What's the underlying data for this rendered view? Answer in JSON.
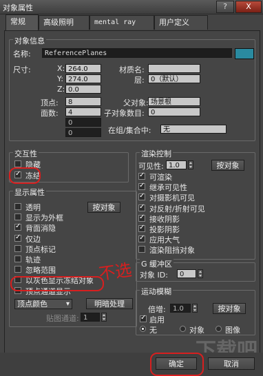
{
  "window": {
    "title": "对象属性",
    "help_btn": "?",
    "close_btn": "X"
  },
  "tabs": [
    "常规",
    "高级照明",
    "mental ray",
    "用户定义"
  ],
  "object_info": {
    "group_title": "对象信息",
    "name_label": "名称:",
    "name_value": "ReferencePlanes",
    "color": "#2a8aa0",
    "size_label": "尺寸:",
    "x_label": "X:",
    "x_value": "264.0",
    "y_label": "Y:",
    "y_value": "274.0",
    "z_label": "Z:",
    "z_value": "0.0",
    "material_label": "材质名:",
    "material_value": "",
    "layer_label": "层:",
    "layer_value": "0（默认）",
    "vertices_label": "顶点:",
    "vertices_value": "8",
    "faces_label": "面数:",
    "faces_value": "4",
    "extra1_value": "0",
    "extra2_value": "0",
    "parent_label": "父对象:",
    "parent_value": "场景根",
    "children_label": "子对象数目:",
    "children_value": "0",
    "in_group_label": "在组/集合中:",
    "in_group_value": "无"
  },
  "interaction": {
    "group_title": "交互性",
    "hide": {
      "label": "隐藏",
      "checked": false
    },
    "freeze": {
      "label": "冻结",
      "checked": true
    }
  },
  "display": {
    "group_title": "显示属性",
    "by_object": "按对象",
    "items": [
      {
        "label": "透明",
        "checked": false
      },
      {
        "label": "显示为外框",
        "checked": false
      },
      {
        "label": "背面消隐",
        "checked": true
      },
      {
        "label": "仅边",
        "checked": true
      },
      {
        "label": "顶点标记",
        "checked": false
      },
      {
        "label": "轨迹",
        "checked": false
      },
      {
        "label": "忽略范围",
        "checked": false
      },
      {
        "label": "以灰色显示冻结对象",
        "checked": false
      },
      {
        "label": "顶点通道显示",
        "checked": false
      }
    ],
    "vertex_color_select": "顶点颜色",
    "shading_btn": "明暗处理",
    "map_channel_label": "贴图通道:",
    "map_channel_value": "1"
  },
  "render": {
    "group_title": "渲染控制",
    "visibility_label": "可见性:",
    "visibility_value": "1.0",
    "by_object": "按对象",
    "items": [
      {
        "label": "可渲染",
        "checked": true
      },
      {
        "label": "继承可见性",
        "checked": true
      },
      {
        "label": "对摄影机可见",
        "checked": true
      },
      {
        "label": "对反射/折射可见",
        "checked": true
      },
      {
        "label": "接收阴影",
        "checked": true
      },
      {
        "label": "投影阴影",
        "checked": true
      },
      {
        "label": "应用大气",
        "checked": true
      },
      {
        "label": "渲染阻挡对象",
        "checked": false
      }
    ]
  },
  "gbuffer": {
    "group_title": "G 缓冲区",
    "object_id_label": "对象 ID:",
    "object_id_value": "0"
  },
  "motion_blur": {
    "group_title": "运动模糊",
    "multiplier_label": "倍增:",
    "multiplier_value": "1.0",
    "by_object": "按对象",
    "enable_label": "启用",
    "none_label": "无",
    "object_label": "对象",
    "image_label": "图像",
    "selected": "none"
  },
  "footer": {
    "ok": "确定",
    "cancel": "取消"
  },
  "annotations": {
    "scribble_text": "不选",
    "watermark": "下载吧"
  },
  "colors": {
    "annotation_red": "#d81f1f",
    "object_swatch": "#2a8aa0"
  }
}
